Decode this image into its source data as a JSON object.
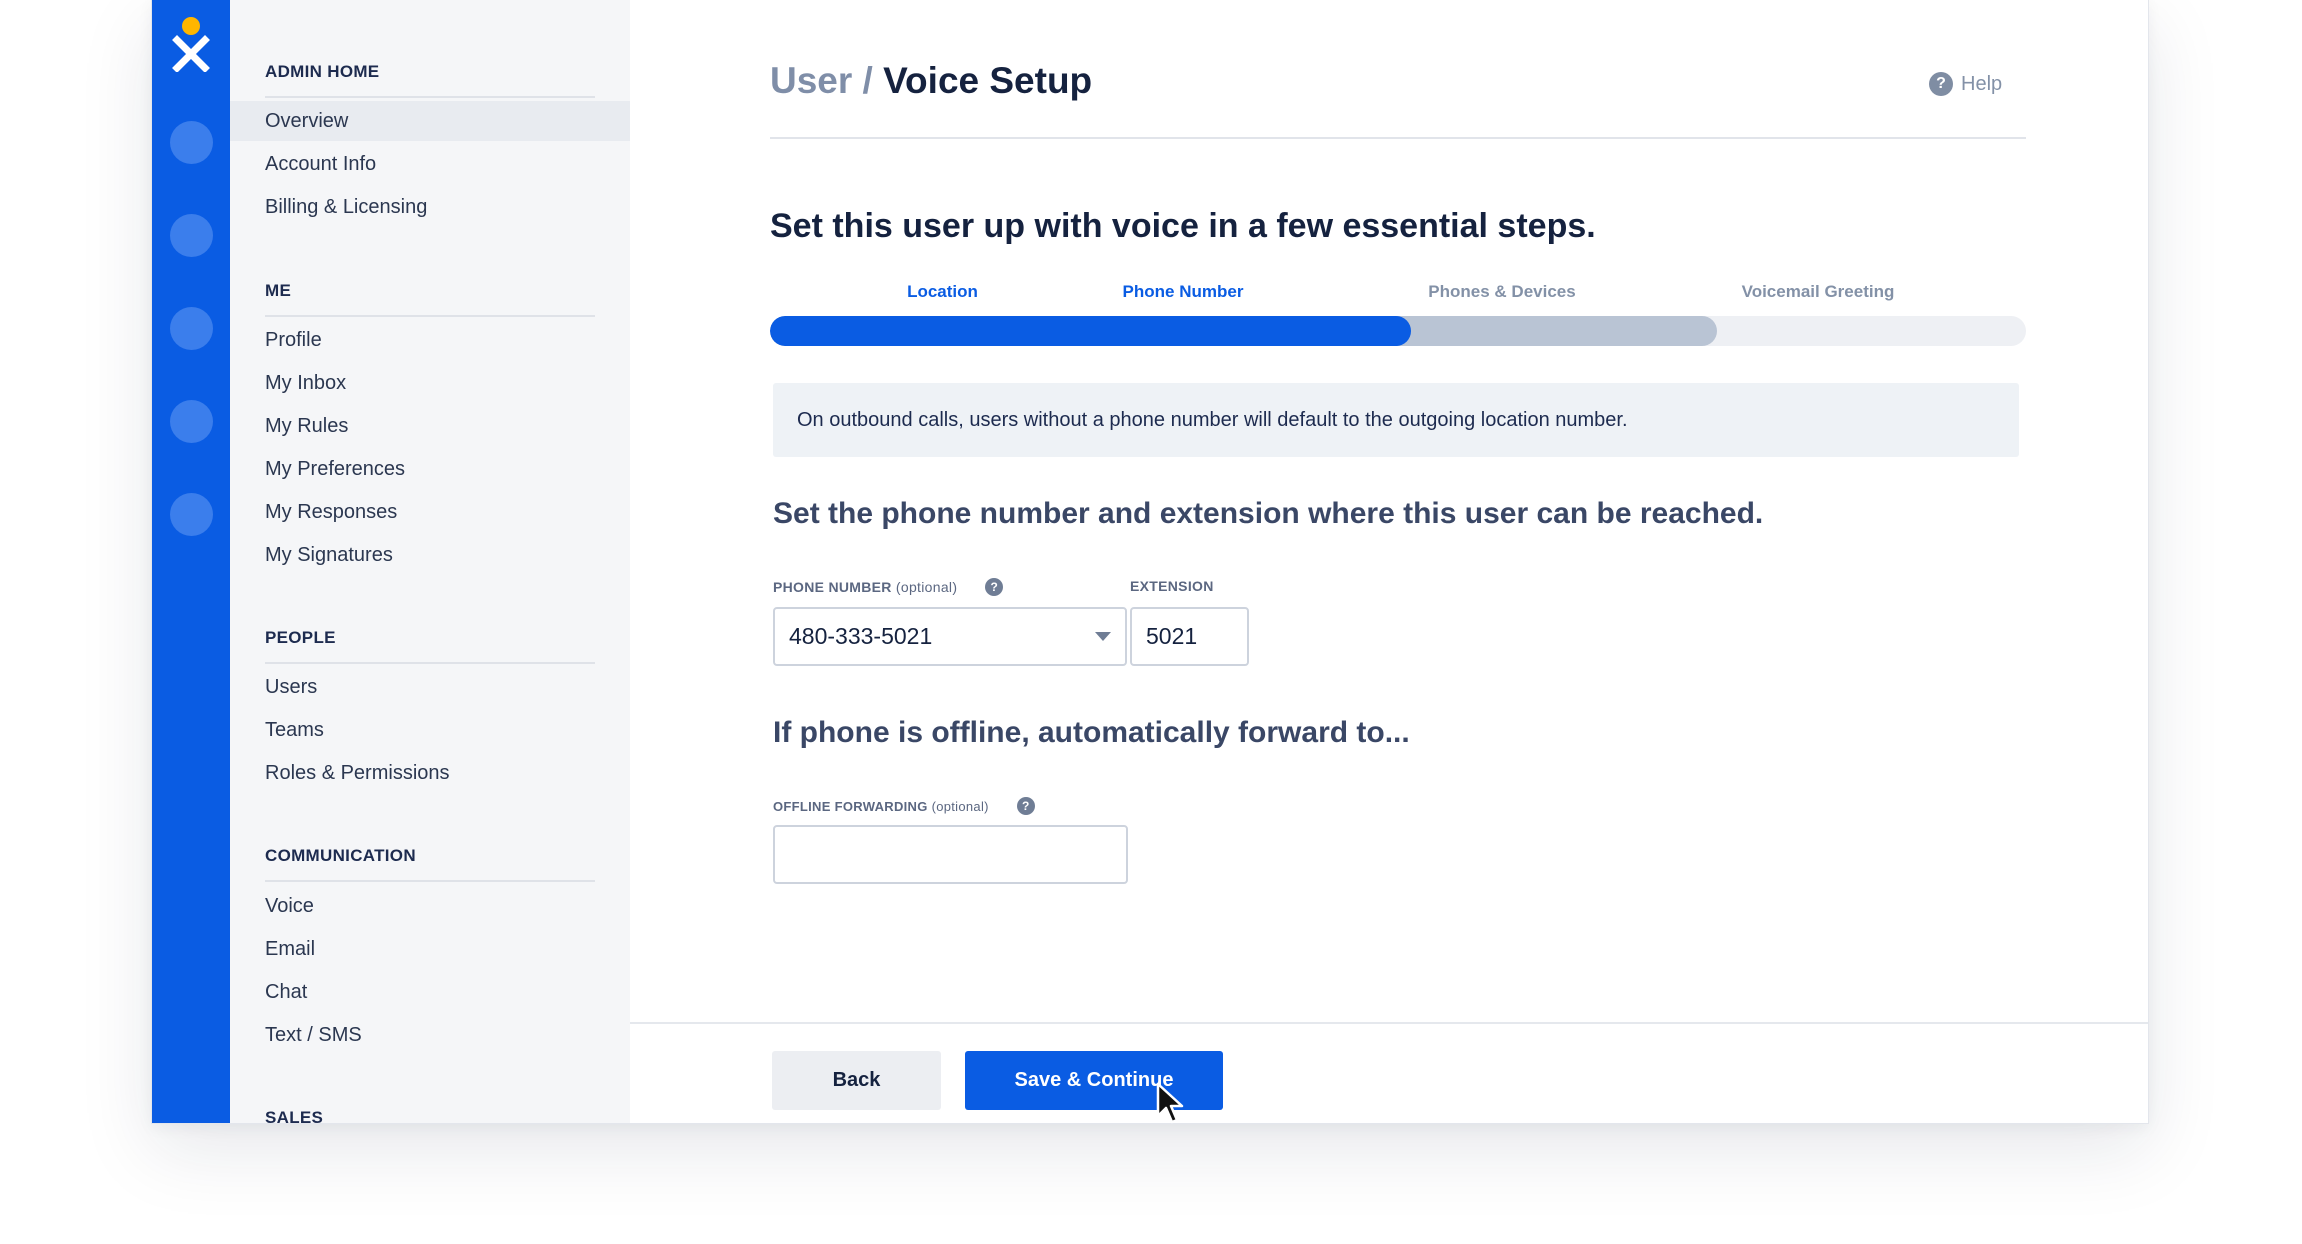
{
  "brand": {
    "logo_icon": "nextiva-x-logo",
    "rail_color": "#0a5ce3",
    "accent": "#0a5ce3"
  },
  "nav": {
    "sections": [
      {
        "heading": "ADMIN HOME",
        "items": [
          "Overview",
          "Account Info",
          "Billing & Licensing"
        ]
      },
      {
        "heading": "ME",
        "items": [
          "Profile",
          "My Inbox",
          "My Rules",
          "My Preferences",
          "My Responses",
          "My Signatures"
        ]
      },
      {
        "heading": "PEOPLE",
        "items": [
          "Users",
          "Teams",
          "Roles & Permissions"
        ]
      },
      {
        "heading": "COMMUNICATION",
        "items": [
          "Voice",
          "Email",
          "Chat",
          "Text / SMS"
        ]
      },
      {
        "heading": "SALES",
        "items": []
      }
    ],
    "active_item": "Overview"
  },
  "header": {
    "breadcrumb": "User /",
    "title": "Voice Setup",
    "help": "Help",
    "help_icon": "question-circle-icon"
  },
  "intro": "Set this user up with voice in a few essential steps.",
  "steps": [
    {
      "label": "Location",
      "state": "done"
    },
    {
      "label": "Phone Number",
      "state": "current"
    },
    {
      "label": "Phones & Devices",
      "state": "todo"
    },
    {
      "label": "Voicemail Greeting",
      "state": "todo"
    }
  ],
  "progress": {
    "completed_fraction": 0.51,
    "secondary_fraction": 0.754
  },
  "notice": "On outbound calls, users without a phone number will default to the outgoing location number.",
  "phone_section": {
    "heading": "Set the phone number and extension where this user can be reached.",
    "phone_label": "PHONE NUMBER",
    "phone_label_optional": "(optional)",
    "phone_value": "480-333-5021",
    "extension_label": "EXTENSION",
    "extension_value": "5021"
  },
  "forward_section": {
    "heading": "If phone is offline, automatically forward to...",
    "label": "OFFLINE FORWARDING",
    "label_optional": "(optional)",
    "value": ""
  },
  "footer": {
    "back_label": "Back",
    "save_label": "Save & Continue"
  }
}
